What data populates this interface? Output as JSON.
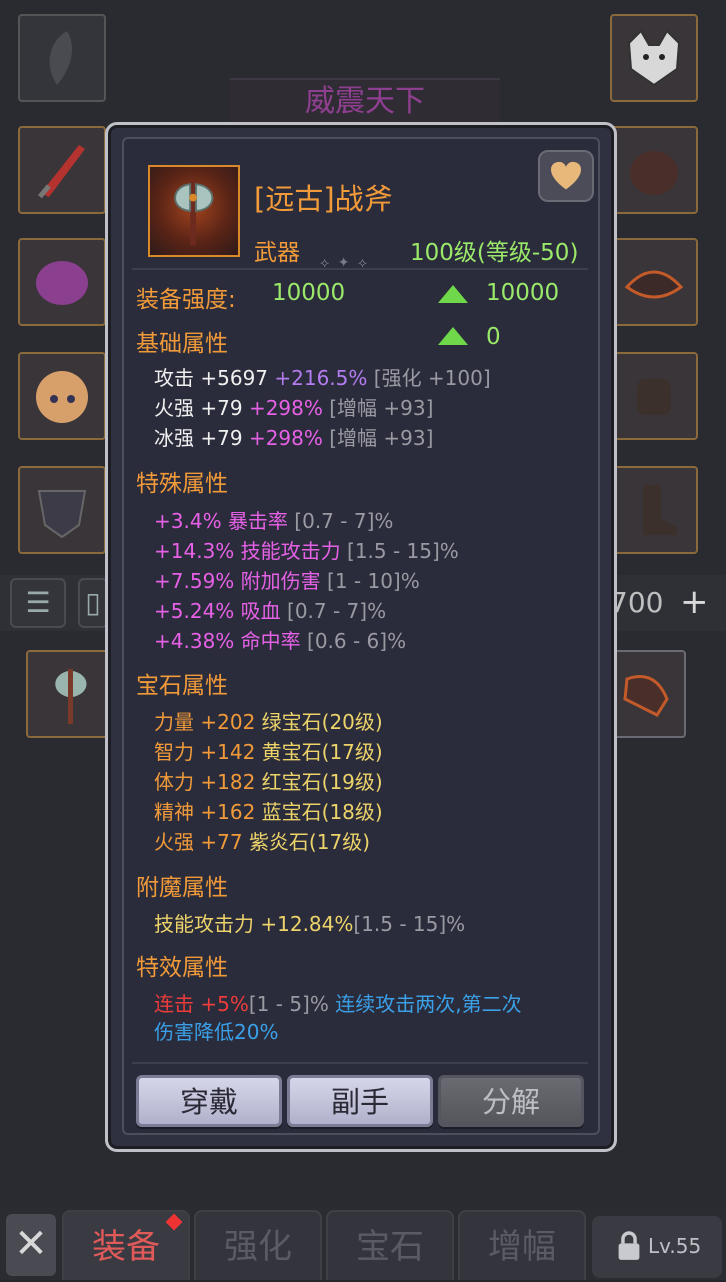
{
  "background": {
    "banner_title": "威震天下",
    "gold_text": "700",
    "plus_label": "+"
  },
  "popup": {
    "item_name": "[远古]战斧",
    "item_type": "武器",
    "item_level": "100级(等级-50)",
    "strength_label": "装备强度:",
    "strength_value": "10000",
    "strength_up_value": "10000",
    "base_section": {
      "title": "基础属性",
      "up_value": "0",
      "lines": [
        {
          "name": "攻击",
          "value": "+5697",
          "bonus": "+216.5%",
          "note": "[强化 +100]"
        },
        {
          "name": "火强",
          "value": "+79",
          "bonus": "+298%",
          "note": "[增幅 +93]"
        },
        {
          "name": "冰强",
          "value": "+79",
          "bonus": "+298%",
          "note": "[增幅 +93]"
        }
      ]
    },
    "special_section": {
      "title": "特殊属性",
      "lines": [
        {
          "value": "+3.4%",
          "name": "暴击率",
          "range": "[0.7 - 7]%"
        },
        {
          "value": "+14.3%",
          "name": "技能攻击力",
          "range": "[1.5 - 15]%"
        },
        {
          "value": "+7.59%",
          "name": "附加伤害",
          "range": "[1 - 10]%"
        },
        {
          "value": "+5.24%",
          "name": "吸血",
          "range": "[0.7 - 7]%"
        },
        {
          "value": "+4.38%",
          "name": "命中率",
          "range": "[0.6 - 6]%"
        }
      ]
    },
    "gem_section": {
      "title": "宝石属性",
      "lines": [
        {
          "stat": "力量 +202",
          "gem": "绿宝石(20级)"
        },
        {
          "stat": "智力 +142",
          "gem": "黄宝石(17级)"
        },
        {
          "stat": "体力 +182",
          "gem": "红宝石(19级)"
        },
        {
          "stat": "精神 +162",
          "gem": "蓝宝石(18级)"
        },
        {
          "stat": "火强 +77",
          "gem": "紫炎石(17级)"
        }
      ]
    },
    "enchant_section": {
      "title": "附魔属性",
      "line": {
        "stat": "技能攻击力 +12.84%",
        "range": "[1.5 - 15]%"
      }
    },
    "effect_section": {
      "title": "特效属性",
      "name": "连击",
      "value": "+5%",
      "range": "[1 - 5]%",
      "desc1": "连续攻击两次,第二次",
      "desc2": "伤害降低20%"
    },
    "buttons": {
      "equip": "穿戴",
      "offhand": "副手",
      "dismantle": "分解"
    }
  },
  "tabs": {
    "close": "✕",
    "items": [
      "装备",
      "强化",
      "宝石",
      "增幅"
    ],
    "locked_label": "Lv.55"
  },
  "colors": {
    "accent_orange": "#f09a39",
    "green": "#9be96a",
    "magenta": "#e661e6",
    "purple": "#b37cf0",
    "yellow": "#ecd36a",
    "red": "#ee3b3b",
    "blue": "#3aa0e8"
  }
}
